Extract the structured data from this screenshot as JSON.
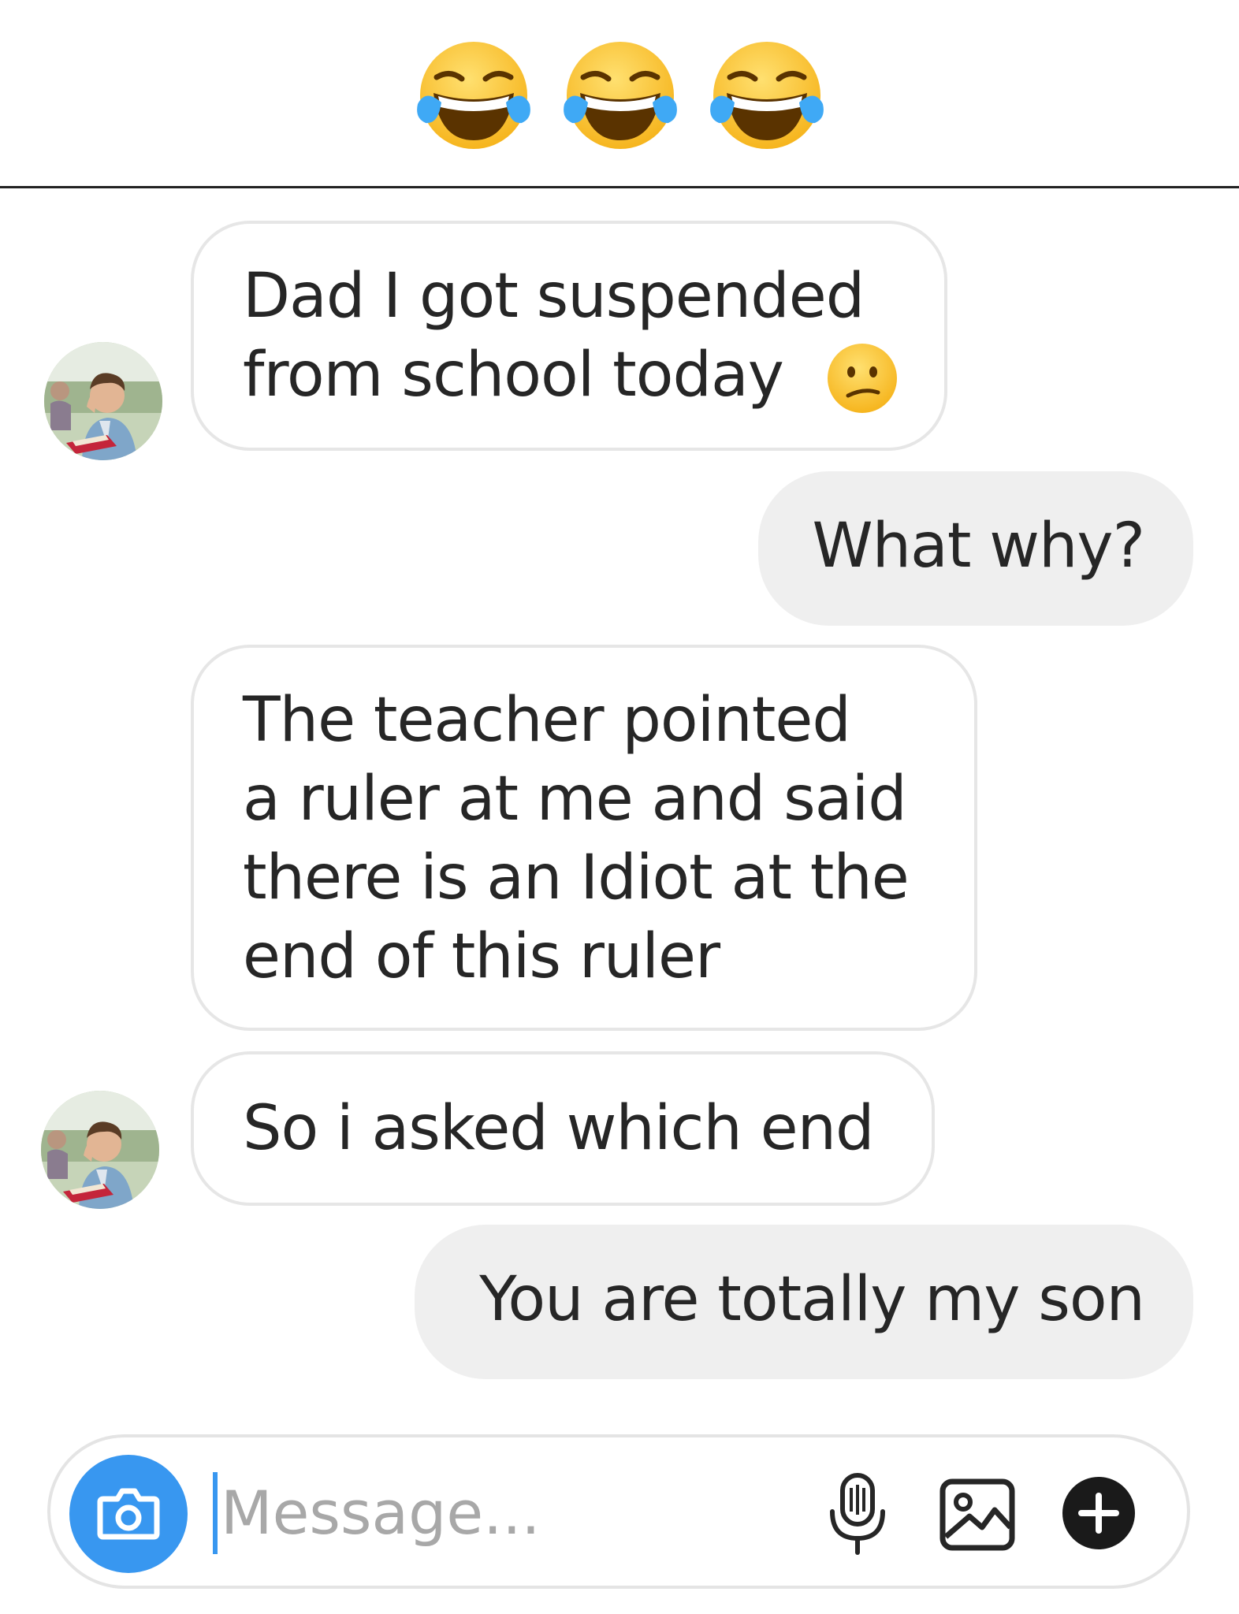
{
  "header": {
    "emojis": [
      "face-with-tears-of-joy",
      "face-with-tears-of-joy",
      "face-with-tears-of-joy"
    ]
  },
  "messages": [
    {
      "sender": "contact",
      "lines": [
        "Dad I got suspended",
        "from school today"
      ],
      "emoji": "confused-face"
    },
    {
      "sender": "me",
      "lines": [
        "What why?"
      ]
    },
    {
      "sender": "contact",
      "lines": [
        "The teacher pointed",
        "a ruler at me and said",
        "there is an Idiot at the",
        "end of this ruler"
      ]
    },
    {
      "sender": "contact",
      "lines": [
        "So i asked which end"
      ]
    },
    {
      "sender": "me",
      "lines": [
        "You are totally my son"
      ]
    }
  ],
  "composer": {
    "placeholder": "Message...",
    "icons": [
      "camera-icon",
      "microphone-icon",
      "gallery-icon",
      "plus-icon"
    ]
  },
  "colors": {
    "accent": "#3897f0",
    "outgoing_bubble": "#efefef",
    "incoming_border": "#e6e6e6",
    "text": "#262626"
  }
}
